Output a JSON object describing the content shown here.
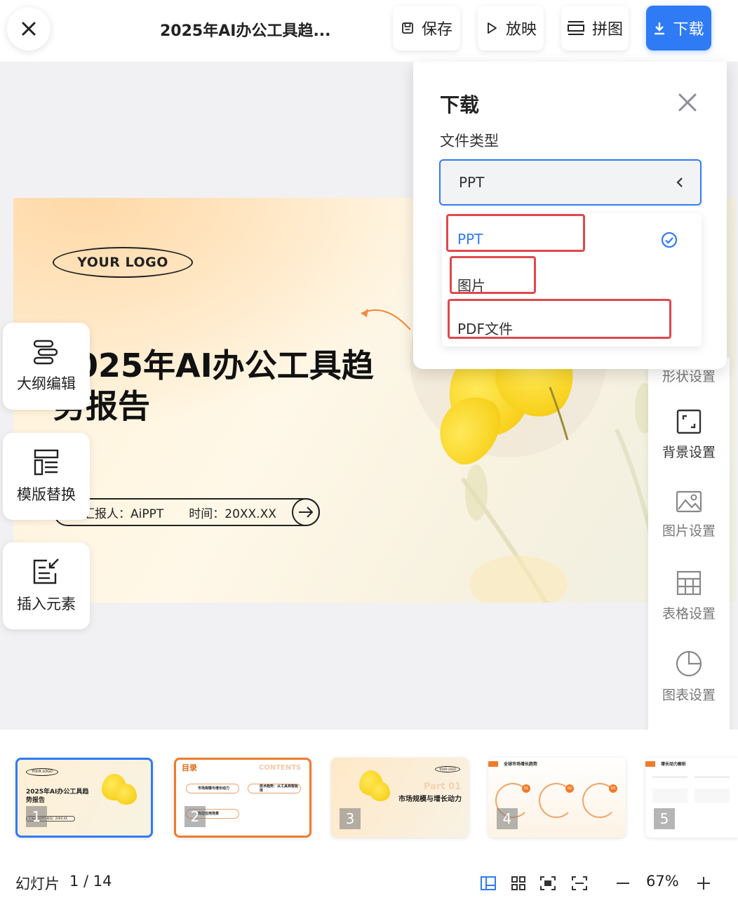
{
  "topbar": {
    "title": "2025年AI办公工具趋...",
    "save_label": "保存",
    "play_label": "放映",
    "puzzle_label": "拼图",
    "download_label": "下载",
    "accent": "#2f7bf6"
  },
  "slide": {
    "logo_text": "YOUR LOGO",
    "title": "2025年AI办公工具趋势报告",
    "presenter": "汇报人：AiPPT",
    "time": "时间：20XX.XX"
  },
  "left_tools": [
    {
      "label": "大纲编辑",
      "icon": "outline-icon"
    },
    {
      "label": "模版替换",
      "icon": "template-icon"
    },
    {
      "label": "插入元素",
      "icon": "insert-icon"
    }
  ],
  "right_panel": [
    {
      "label": "形状设置",
      "icon": "shape-icon"
    },
    {
      "label": "背景设置",
      "icon": "background-icon"
    },
    {
      "label": "图片设置",
      "icon": "image-icon"
    },
    {
      "label": "表格设置",
      "icon": "table-icon"
    },
    {
      "label": "图表设置",
      "icon": "chart-pie-icon"
    }
  ],
  "download_panel": {
    "title": "下载",
    "file_type_label": "文件类型",
    "selected": "PPT",
    "options": [
      "PPT",
      "图片",
      "PDF文件"
    ],
    "highlight_color": "#e0484c"
  },
  "thumbnails": [
    {
      "num": "1",
      "title": "2025年AI办公工具趋势报告",
      "logo": "YOUR LOGO",
      "footer": "汇报人  AiPPT  时间：20XX.XX"
    },
    {
      "num": "2",
      "heading": "目录",
      "watermark": "CONTENTS",
      "items": [
        "市场规模与增长动力",
        "技术趋势：从工具到智能体",
        "典型应用场景"
      ]
    },
    {
      "num": "3",
      "part": "Part 01",
      "title": "市场规模与增长动力",
      "logo": "YOUR LOGO"
    },
    {
      "num": "4",
      "heading": "全球市场增长趋势",
      "badges": [
        "01",
        "02",
        "03"
      ]
    },
    {
      "num": "5",
      "heading": "增长动力解析"
    }
  ],
  "status": {
    "slide_label": "幻灯片",
    "page": "1 / 14",
    "zoom": "67%"
  }
}
